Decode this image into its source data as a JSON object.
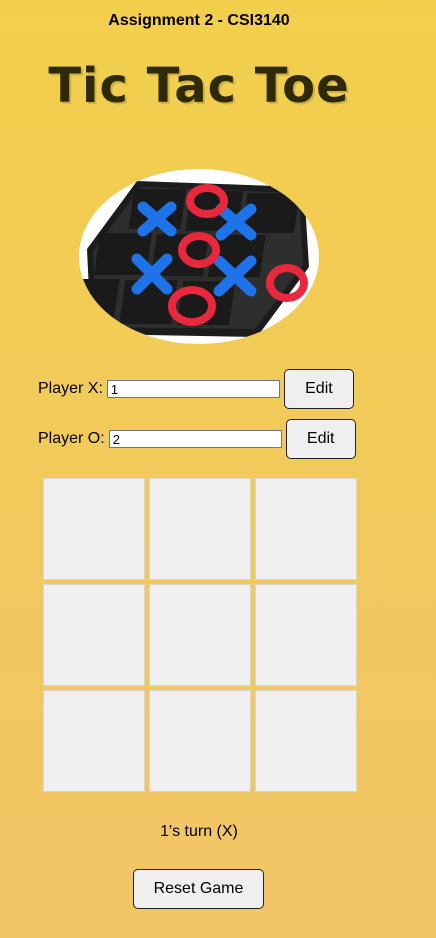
{
  "header": {
    "assignment": "Assignment 2 - CSI3140",
    "title": "Tic Tac Toe"
  },
  "players": [
    {
      "label": "Player X:",
      "value": "1",
      "edit_label": "Edit"
    },
    {
      "label": "Player O:",
      "value": "2",
      "edit_label": "Edit"
    }
  ],
  "board": {
    "cells": [
      "",
      "",
      "",
      "",
      "",
      "",
      "",
      "",
      ""
    ]
  },
  "status": {
    "turn_text": "1's turn (X)"
  },
  "reset_label": "Reset Game",
  "colors": {
    "background_top": "#f2cf4b",
    "background_bottom": "#f2c566",
    "title": "#2e2a06",
    "cell": "#efefef",
    "x_piece": "#1e73e8",
    "o_piece": "#e8283c"
  }
}
